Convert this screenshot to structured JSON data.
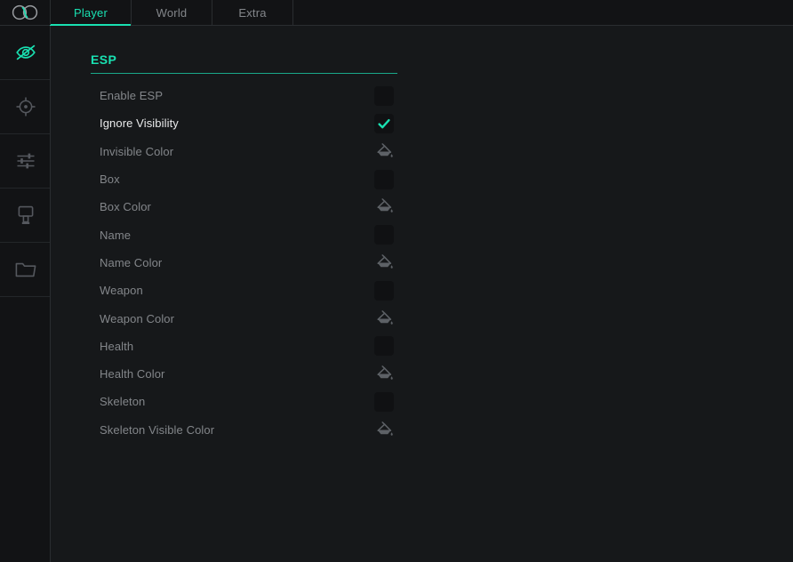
{
  "app": {
    "logo_icon": "infinity-logo-icon",
    "accent_color": "#19e0b1",
    "background_color": "#16181a",
    "panel_background_color": "#121315",
    "muted_text_color": "#83868a",
    "active_text_color": "#e9eaeb"
  },
  "tabs": [
    {
      "label": "Player",
      "active": true
    },
    {
      "label": "World",
      "active": false
    },
    {
      "label": "Extra",
      "active": false
    }
  ],
  "sidebar": {
    "items": [
      {
        "icon": "eye-slash-icon",
        "name": "sidebar-item-esp",
        "active": true
      },
      {
        "icon": "crosshair-icon",
        "name": "sidebar-item-aim",
        "active": false
      },
      {
        "icon": "sliders-icon",
        "name": "sidebar-item-settings",
        "active": false
      },
      {
        "icon": "stamp-icon",
        "name": "sidebar-item-skins",
        "active": false
      },
      {
        "icon": "folder-icon",
        "name": "sidebar-item-configs",
        "active": false
      }
    ]
  },
  "panel": {
    "title": "ESP",
    "rows": [
      {
        "label": "Enable ESP",
        "control": "checkbox",
        "checked": false,
        "highlight": false
      },
      {
        "label": "Ignore Visibility",
        "control": "checkbox",
        "checked": true,
        "highlight": true
      },
      {
        "label": "Invisible Color",
        "control": "color",
        "highlight": false
      },
      {
        "label": "Box",
        "control": "checkbox",
        "checked": false,
        "highlight": false
      },
      {
        "label": "Box Color",
        "control": "color",
        "highlight": false
      },
      {
        "label": "Name",
        "control": "checkbox",
        "checked": false,
        "highlight": false
      },
      {
        "label": "Name Color",
        "control": "color",
        "highlight": false
      },
      {
        "label": "Weapon",
        "control": "checkbox",
        "checked": false,
        "highlight": false
      },
      {
        "label": "Weapon Color",
        "control": "color",
        "highlight": false
      },
      {
        "label": "Health",
        "control": "checkbox",
        "checked": false,
        "highlight": false
      },
      {
        "label": "Health Color",
        "control": "color",
        "highlight": false
      },
      {
        "label": "Skeleton",
        "control": "checkbox",
        "checked": false,
        "highlight": false
      },
      {
        "label": "Skeleton Visible Color",
        "control": "color",
        "highlight": false
      }
    ]
  }
}
